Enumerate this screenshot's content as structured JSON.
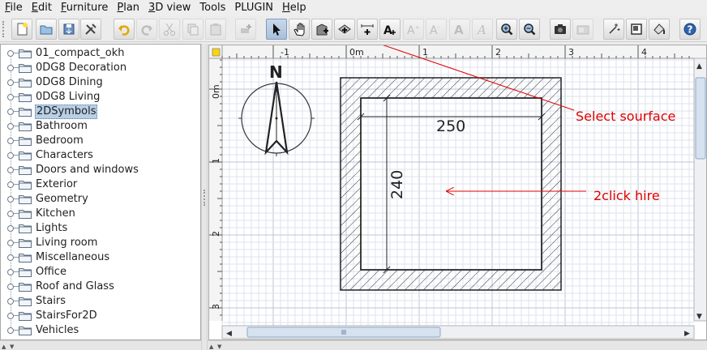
{
  "menubar": {
    "items": [
      {
        "label": "File",
        "u": "F",
        "rest": "ile"
      },
      {
        "label": "Edit",
        "u": "E",
        "rest": "dit"
      },
      {
        "label": "Furniture",
        "u": "F",
        "rest": "urniture"
      },
      {
        "label": "Plan",
        "u": "P",
        "rest": "lan"
      },
      {
        "label": "3D view",
        "u": "3",
        "rest": "D view"
      },
      {
        "label": "Tools",
        "u": "",
        "rest": "Tools"
      },
      {
        "label": "PLUGIN",
        "u": "",
        "rest": "PLUGIN"
      },
      {
        "label": "Help",
        "u": "H",
        "rest": "elp"
      }
    ]
  },
  "toolbar": {
    "buttons": [
      {
        "name": "new-home-button",
        "icon": "new-file-icon"
      },
      {
        "name": "open-button",
        "icon": "open-folder-icon"
      },
      {
        "name": "save-button",
        "icon": "save-icon"
      },
      {
        "name": "preferences-button",
        "icon": "tools-icon"
      },
      {
        "name": "undo-button",
        "icon": "undo-icon"
      },
      {
        "name": "redo-button",
        "icon": "redo-icon",
        "disabled": true
      },
      {
        "name": "cut-button",
        "icon": "cut-icon",
        "disabled": true
      },
      {
        "name": "copy-button",
        "icon": "copy-icon",
        "disabled": true
      },
      {
        "name": "paste-button",
        "icon": "paste-icon",
        "disabled": true
      },
      {
        "name": "add-furniture-button",
        "icon": "add-furniture-icon",
        "disabled": true
      },
      {
        "name": "select-mode-button",
        "icon": "arrow-pointer-icon",
        "selected": true
      },
      {
        "name": "pan-mode-button",
        "icon": "hand-icon"
      },
      {
        "name": "create-walls-button",
        "icon": "wall-plus-icon"
      },
      {
        "name": "create-rooms-button",
        "icon": "room-plus-icon"
      },
      {
        "name": "create-dimensions-button",
        "icon": "dimension-plus-icon"
      },
      {
        "name": "create-labels-button",
        "icon": "text-plus-icon"
      },
      {
        "name": "increase-text-button",
        "icon": "text-increase-icon",
        "disabled": true
      },
      {
        "name": "decrease-text-button",
        "icon": "text-decrease-icon",
        "disabled": true
      },
      {
        "name": "bold-button",
        "icon": "bold-icon",
        "disabled": true
      },
      {
        "name": "italic-button",
        "icon": "italic-icon",
        "disabled": true
      },
      {
        "name": "zoom-in-button",
        "icon": "zoom-in-icon"
      },
      {
        "name": "zoom-out-button",
        "icon": "zoom-out-icon"
      },
      {
        "name": "create-photo-button",
        "icon": "camera-icon"
      },
      {
        "name": "create-video-button",
        "icon": "video-icon",
        "disabled": true
      },
      {
        "name": "plugin-button-1",
        "icon": "sparkle-icon"
      },
      {
        "name": "plugin-button-2",
        "icon": "frame-icon"
      },
      {
        "name": "plugin-button-3",
        "icon": "paint-icon"
      },
      {
        "name": "help-button",
        "icon": "help-icon"
      }
    ]
  },
  "catalog": {
    "items": [
      "01_compact_okh",
      "0DG8 Decoration",
      "0DG8 Dining",
      "0DG8 Living",
      "2DSymbols",
      "Bathroom",
      "Bedroom",
      "Characters",
      "Doors and windows",
      "Exterior",
      "Geometry",
      "Kitchen",
      "Lights",
      "Living room",
      "Miscellaneous",
      "Office",
      "Roof and Glass",
      "Stairs",
      "StairsFor2D",
      "Vehicles"
    ],
    "selected_index": 4
  },
  "plan": {
    "ruler_top": [
      "-1",
      "0m",
      "1",
      "2",
      "3",
      "4"
    ],
    "ruler_left": [
      "0m",
      "1",
      "2",
      "3"
    ],
    "compass_label": "N",
    "dim_width": "250",
    "dim_height": "240"
  },
  "annotations": {
    "select_surface": "Select sourface",
    "double_click": "2click hire",
    "color": "#e00000"
  }
}
